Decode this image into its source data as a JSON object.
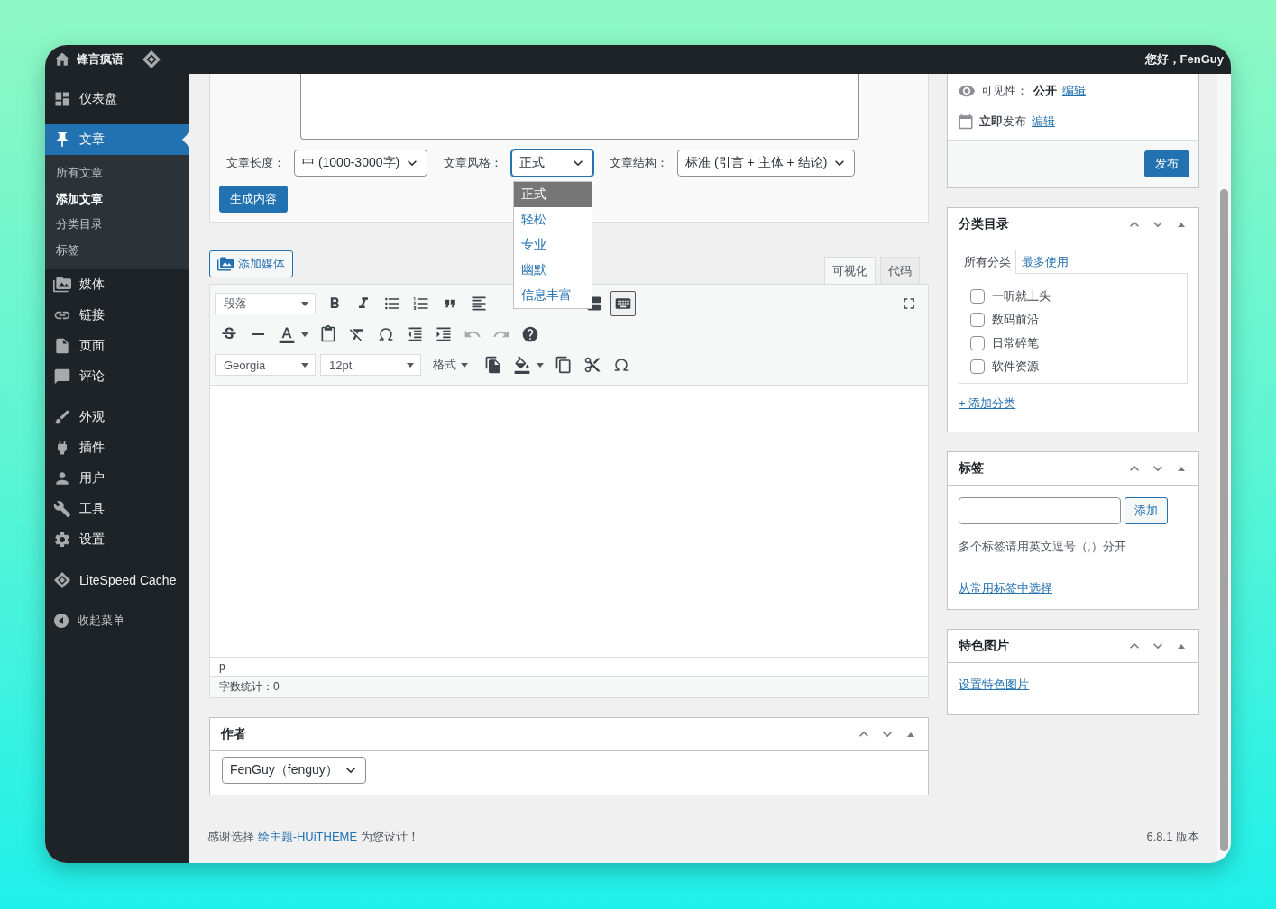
{
  "admin_bar": {
    "site_name": "锋言疯语",
    "greeting": "您好，FenGuy"
  },
  "sidebar": {
    "groups": [
      [
        {
          "label": "仪表盘",
          "selected": false
        }
      ],
      [
        {
          "label": "文章",
          "selected": true,
          "children": [
            {
              "label": "所有文章",
              "selected": false
            },
            {
              "label": "添加文章",
              "selected": true
            },
            {
              "label": "分类目录",
              "selected": false
            },
            {
              "label": "标签",
              "selected": false
            }
          ]
        },
        {
          "label": "媒体",
          "selected": false
        },
        {
          "label": "链接",
          "selected": false
        },
        {
          "label": "页面",
          "selected": false
        },
        {
          "label": "评论",
          "selected": false
        }
      ],
      [
        {
          "label": "外观",
          "selected": false
        },
        {
          "label": "插件",
          "selected": false
        },
        {
          "label": "用户",
          "selected": false
        },
        {
          "label": "工具",
          "selected": false
        },
        {
          "label": "设置",
          "selected": false
        }
      ],
      [
        {
          "label": "LiteSpeed Cache",
          "selected": false
        }
      ]
    ],
    "collapse": "收起菜单"
  },
  "generator": {
    "fields": [
      {
        "label": "文章长度：",
        "value": "中 (1000-3000字)",
        "focused": false
      },
      {
        "label": "文章风格：",
        "value": "正式",
        "focused": true
      },
      {
        "label": "文章结构：",
        "value": "标准 (引言 + 主体 + 结论)",
        "focused": false
      }
    ],
    "dropdown": [
      {
        "label": "正式",
        "selected": true
      },
      {
        "label": "轻松",
        "selected": false
      },
      {
        "label": "专业",
        "selected": false
      },
      {
        "label": "幽默",
        "selected": false
      },
      {
        "label": "信息丰富",
        "selected": false
      }
    ],
    "button": "生成内容"
  },
  "editor": {
    "add_media": "添加媒体",
    "tabs": [
      {
        "label": "可视化",
        "selected": true
      },
      {
        "label": "代码",
        "selected": false
      }
    ],
    "toolbar_rows": [
      [
        {
          "kind": "select",
          "value": "段落"
        },
        {
          "kind": "bold",
          "pressed": false,
          "disabled": false
        },
        {
          "kind": "italic",
          "pressed": false,
          "disabled": false
        },
        {
          "kind": "bullet_list",
          "pressed": false,
          "disabled": false
        },
        {
          "kind": "numbered_list",
          "pressed": false,
          "disabled": false
        },
        {
          "kind": "blockquote",
          "pressed": false,
          "disabled": false
        },
        {
          "kind": "align_left",
          "pressed": false,
          "disabled": false
        },
        {
          "kind": "read_more",
          "pressed": false,
          "disabled": false
        },
        {
          "kind": "toolbar_toggle",
          "pressed": true,
          "disabled": false
        },
        {
          "kind": "fullscreen",
          "pressed": false,
          "disabled": false
        }
      ],
      [
        {
          "kind": "strikethrough",
          "pressed": false,
          "disabled": false
        },
        {
          "kind": "horizontal_line",
          "pressed": false,
          "disabled": false
        },
        {
          "kind": "text_color",
          "pressed": false,
          "disabled": false
        },
        {
          "kind": "paste_text",
          "pressed": false,
          "disabled": false
        },
        {
          "kind": "clear_format",
          "pressed": false,
          "disabled": false
        },
        {
          "kind": "special_char",
          "pressed": false,
          "disabled": false
        },
        {
          "kind": "outdent",
          "pressed": false,
          "disabled": false
        },
        {
          "kind": "indent",
          "pressed": false,
          "disabled": false
        },
        {
          "kind": "undo",
          "pressed": false,
          "disabled": true
        },
        {
          "kind": "redo",
          "pressed": false,
          "disabled": true
        },
        {
          "kind": "help",
          "pressed": false,
          "disabled": false
        }
      ],
      [
        {
          "kind": "select",
          "value": "Georgia"
        },
        {
          "kind": "select",
          "value": "12pt"
        },
        {
          "kind": "menu",
          "label": "格式"
        },
        {
          "kind": "copy_format",
          "pressed": false,
          "disabled": false
        },
        {
          "kind": "background_color",
          "pressed": false,
          "disabled": false
        },
        {
          "kind": "copy",
          "pressed": false,
          "disabled": false
        },
        {
          "kind": "cut",
          "pressed": false,
          "disabled": false
        },
        {
          "kind": "special_char",
          "pressed": false,
          "disabled": false
        }
      ]
    ],
    "path": "p",
    "word_count": "字数统计：0"
  },
  "author": {
    "title": "作者",
    "value": "FenGuy（fenguy）"
  },
  "footer": {
    "thanks_before": "感谢选择 ",
    "theme_link": "绘主题-HUiTHEME",
    "thanks_after": " 为您设计！",
    "version": "6.8.1 版本"
  },
  "publish": {
    "visibility_label": "可见性：",
    "visibility_value": "公开",
    "visibility_edit": "编辑",
    "schedule": "**立即**发布",
    "schedule_edit": "编辑",
    "button": "发布"
  },
  "categories": {
    "title": "分类目录",
    "tabs": [
      {
        "label": "所有分类",
        "selected": true
      },
      {
        "label": "最多使用",
        "selected": false
      }
    ],
    "items": [
      {
        "label": "一听就上头",
        "checked": false
      },
      {
        "label": "数码前沿",
        "checked": false
      },
      {
        "label": "日常碎笔",
        "checked": false
      },
      {
        "label": "软件资源",
        "checked": false
      }
    ],
    "add_link": "+ 添加分类"
  },
  "tags": {
    "title": "标签",
    "add_button": "添加",
    "hint": "多个标签请用英文逗号（,）分开",
    "choose_link": "从常用标签中选择"
  },
  "featured_image": {
    "title": "特色图片",
    "link": "设置特色图片"
  }
}
